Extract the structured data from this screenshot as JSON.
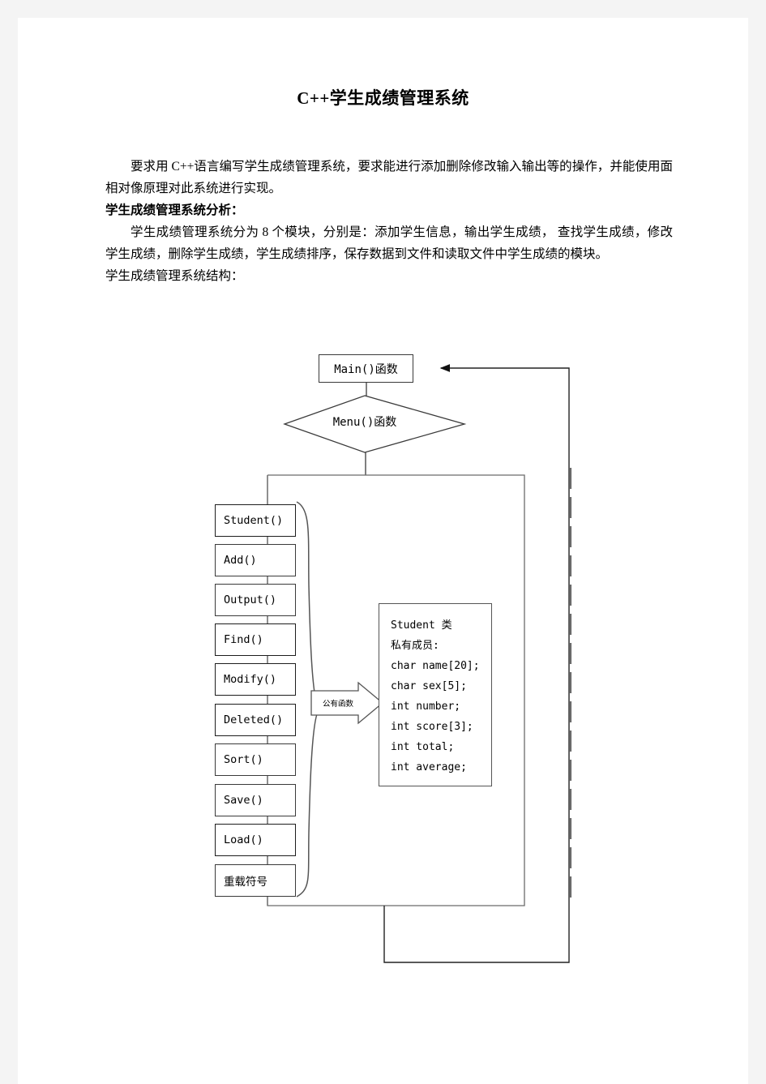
{
  "document": {
    "title": "C++学生成绩管理系统",
    "paragraphs": [
      {
        "id": "intro",
        "style": "indent",
        "text": "要求用 C++语言编写学生成绩管理系统，要求能进行添加删除修改输入输出等的操作，并能使用面相对像原理对此系统进行实现。"
      },
      {
        "id": "analysis-heading",
        "style": "bold",
        "text": "学生成绩管理系统分析："
      },
      {
        "id": "analysis-body",
        "style": "indent",
        "text": "学生成绩管理系统分为 8 个模块，分别是：添加学生信息，输出学生成绩， 查找学生成绩，修改学生成绩，删除学生成绩，学生成绩排序，保存数据到文件和读取文件中学生成绩的模块。"
      },
      {
        "id": "structure-heading",
        "style": "plain",
        "text": "学生成绩管理系统结构："
      }
    ]
  },
  "diagram": {
    "main_node": "Main()函数",
    "menu_node": "Menu()函数",
    "function_boxes": [
      "Student()",
      "Add()",
      "Output()",
      "Find()",
      "Modify()",
      "Deleted()",
      "Sort()",
      "Save()",
      "Load()",
      "重载符号"
    ],
    "arrow_label": "公有函数",
    "class_box": {
      "title": "Student 类",
      "section": "私有成员:",
      "members": [
        "char name[20];",
        "char sex[5];",
        "int number;",
        "int score[3];",
        "int total;",
        "int average;"
      ]
    }
  },
  "colors": {
    "page": "#ffffff",
    "margin": "#f4f4f4",
    "line": "#3a3a3a",
    "text": "#000000"
  }
}
